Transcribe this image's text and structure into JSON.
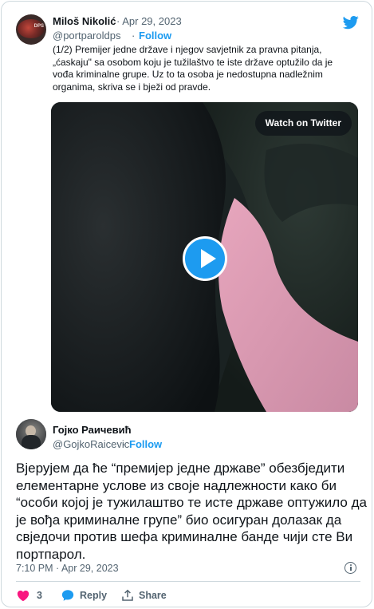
{
  "quoted_tweet": {
    "author_name": "Miloš Nikolić",
    "author_handle": "@portparoldps",
    "date": "· Apr 29, 2023",
    "separator": "·",
    "follow_label": "Follow",
    "avatar_text": "DPS",
    "text": "(1/2) Premijer jedne države i njegov savjetnik za pravna pitanja, „ćaskaju\" sa osobom koju je tužilaštvo te iste države optužilo da je vođa kriminalne grupe. Uz to ta osoba je nedostupna nadležnim organima, skriva se i bježi od pravde."
  },
  "video": {
    "watch_label": "Watch on Twitter",
    "play_icon": "play-icon"
  },
  "main_tweet": {
    "author_name": "Гојко Раичевић",
    "author_handle": "@GojkoRaicevic",
    "separator": "·",
    "follow_label": "Follow",
    "text": "Вјерујем да ће “премијер једне државе” обезбједити елементарне услове из своје надлежности како би “особи којој је тужилаштво те исте државе оптужило да је вођа криминалне групе” био осигуран долазак да свједочи против шефа криминалне банде чији сте Ви портпарол.",
    "timestamp": "7:10 PM · Apr 29, 2023"
  },
  "actions": {
    "like_count": "3",
    "reply_label": "Reply",
    "share_label": "Share"
  },
  "colors": {
    "accent": "#1d9bf0",
    "like": "#f91880",
    "muted": "#536471",
    "border": "#cfd9de"
  }
}
